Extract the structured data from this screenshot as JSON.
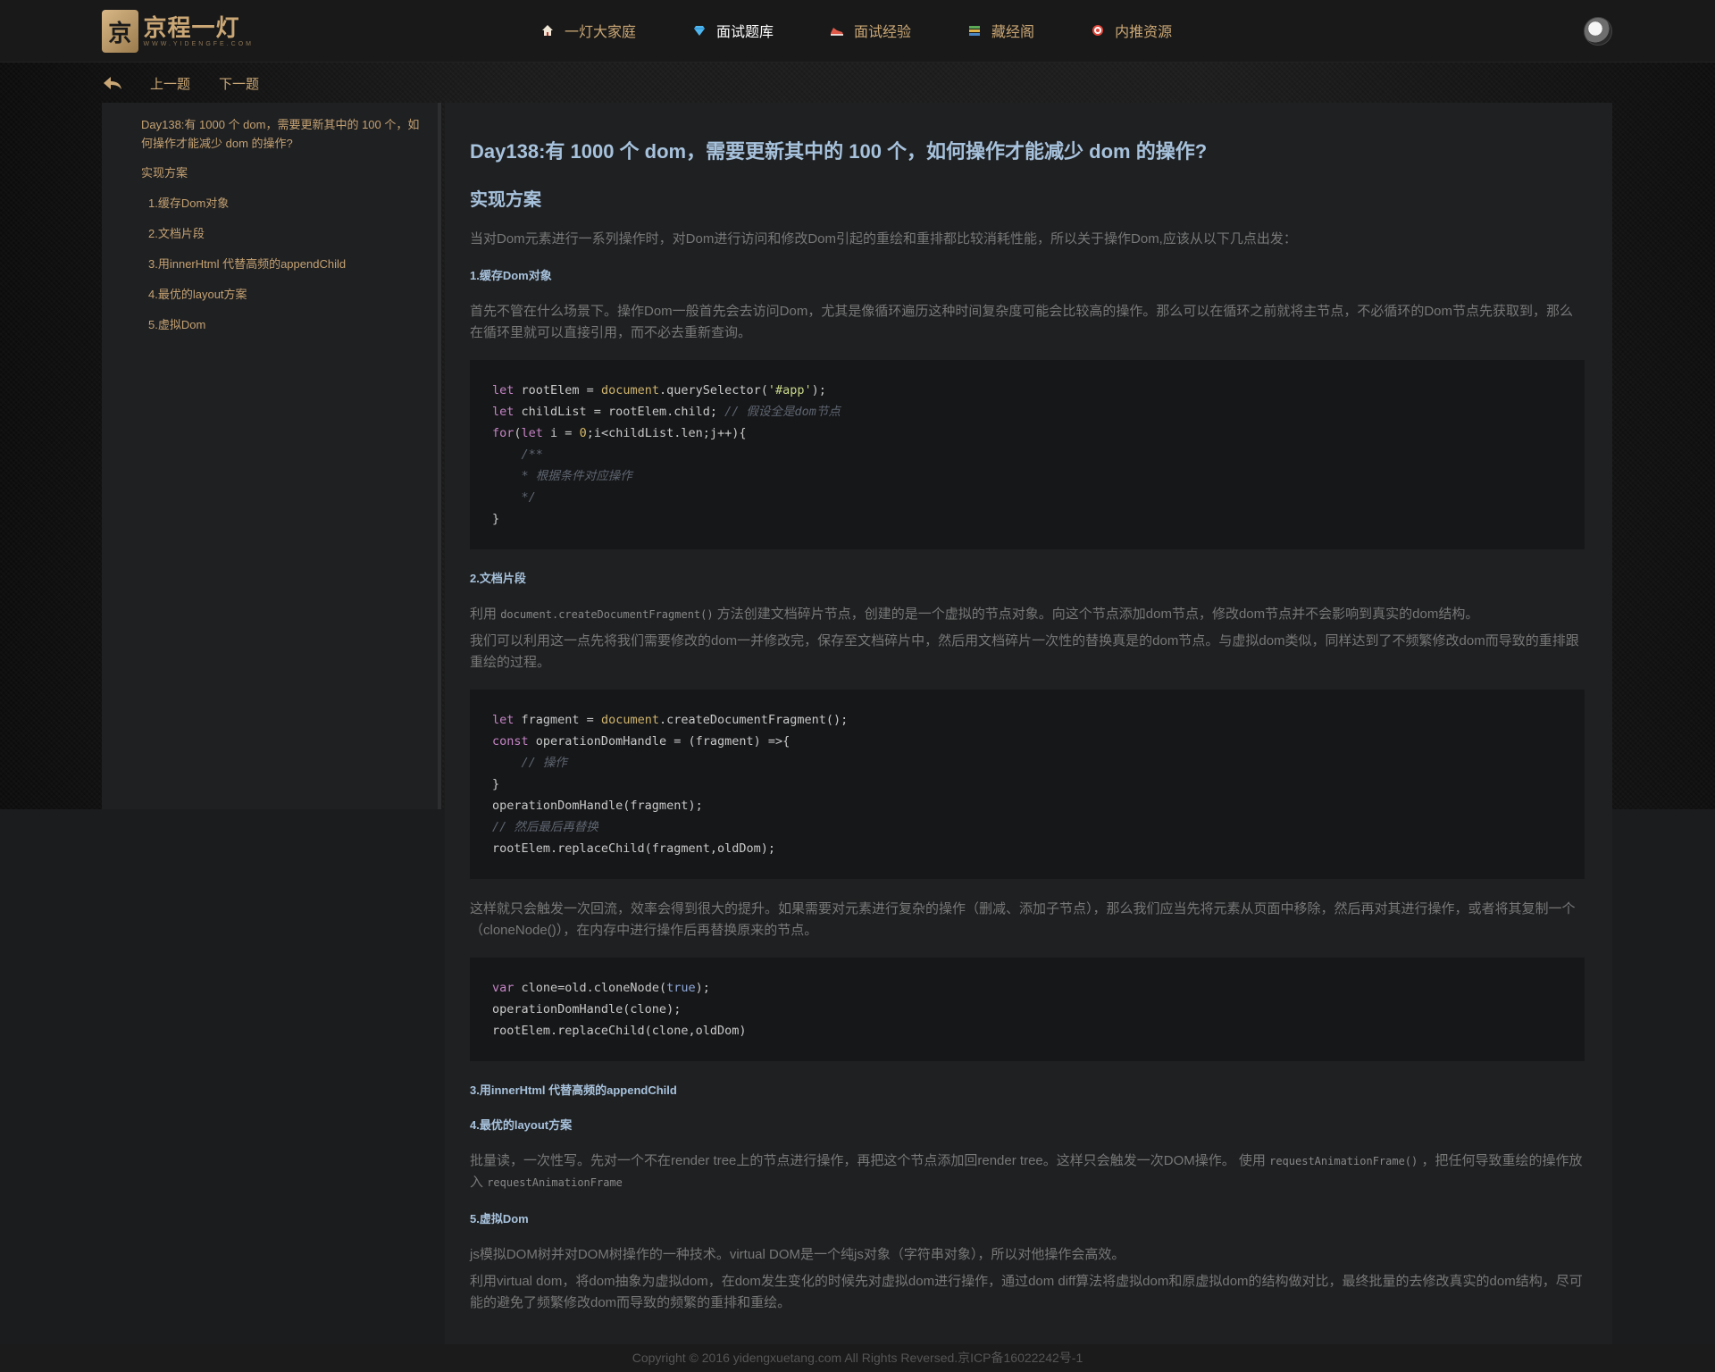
{
  "brand": {
    "logo_mark": "京",
    "name": "京程一灯",
    "subtitle": "WWW.YIDENGFE.COM"
  },
  "nav": {
    "items": [
      {
        "label": "一灯大家庭",
        "icon": "home-icon",
        "active": false
      },
      {
        "label": "面试题库",
        "icon": "diamond-icon",
        "active": true
      },
      {
        "label": "面试经验",
        "icon": "sneaker-icon",
        "active": false
      },
      {
        "label": "藏经阁",
        "icon": "books-icon",
        "active": false
      },
      {
        "label": "内推资源",
        "icon": "target-icon",
        "active": false
      }
    ]
  },
  "subnav": {
    "prev": "上一题",
    "next": "下一题"
  },
  "toc": {
    "title": "Day138:有 1000 个 dom，需要更新其中的 100 个，如何操作才能减少 dom 的操作?",
    "heading": "实现方案",
    "items": [
      "1.缓存Dom对象",
      "2.文档片段",
      "3.用innerHtml 代替高频的appendChild",
      "4.最优的layout方案",
      "5.虚拟Dom"
    ]
  },
  "article": {
    "title": "Day138:有 1000 个 dom，需要更新其中的 100 个，如何操作才能减少 dom 的操作?",
    "section": "实现方案",
    "intro": "当对Dom元素进行一系列操作时，对Dom进行访问和修改Dom引起的重绘和重排都比较消耗性能，所以关于操作Dom,应该从以下几点出发：",
    "s1_title": "1.缓存Dom对象",
    "s1_p": "首先不管在什么场景下。操作Dom一般首先会去访问Dom，尤其是像循环遍历这种时间复杂度可能会比较高的操作。那么可以在循环之前就将主节点，不必循环的Dom节点先获取到，那么在循环里就可以直接引用，而不必去重新查询。",
    "s2_title": "2.文档片段",
    "s2_p1_a": "利用",
    "s2_p1_code": "document.createDocumentFragment()",
    "s2_p1_b": "方法创建文档碎片节点，创建的是一个虚拟的节点对象。向这个节点添加dom节点，修改dom节点并不会影响到真实的dom结构。",
    "s2_p2": "我们可以利用这一点先将我们需要修改的dom一并修改完，保存至文档碎片中，然后用文档碎片一次性的替换真是的dom节点。与虚拟dom类似，同样达到了不频繁修改dom而导致的重排跟重绘的过程。",
    "s2_p3": "这样就只会触发一次回流，效率会得到很大的提升。如果需要对元素进行复杂的操作（删减、添加子节点），那么我们应当先将元素从页面中移除，然后再对其进行操作，或者将其复制一个（cloneNode()），在内存中进行操作后再替换原来的节点。",
    "s3_title": "3.用innerHtml 代替高频的appendChild",
    "s4_title": "4.最优的layout方案",
    "s4_p_a": "批量读，一次性写。先对一个不在render tree上的节点进行操作，再把这个节点添加回render tree。这样只会触发一次DOM操作。 使用",
    "s4_p_code1": "requestAnimationFrame()",
    "s4_p_b": "，把任何导致重绘的操作放入",
    "s4_p_code2": "requestAnimationFrame",
    "s5_title": "5.虚拟Dom",
    "s5_p1": "js模拟DOM树并对DOM树操作的一种技术。virtual DOM是一个纯js对象（字符串对象），所以对他操作会高效。",
    "s5_p2": "利用virtual dom，将dom抽象为虚拟dom，在dom发生变化的时候先对虚拟dom进行操作，通过dom diff算法将虚拟dom和原虚拟dom的结构做对比，最终批量的去修改真实的dom结构，尽可能的避免了频繁修改dom而导致的频繁的重排和重绘。"
  },
  "code": {
    "block1": [
      "let rootElem = document.querySelector('#app');",
      "let childList = rootElem.child; // 假设全是dom节点",
      "for(let i = 0;i<childList.len;j++){",
      "    /**",
      "    * 根据条件对应操作",
      "    */",
      "}"
    ],
    "block2": [
      "let fragment = document.createDocumentFragment();",
      "const operationDomHandle = (fragment) =>{",
      "    // 操作",
      "}",
      "operationDomHandle(fragment);",
      "// 然后最后再替换",
      "rootElem.replaceChild(fragment,oldDom);"
    ],
    "block3": [
      "var clone=old.cloneNode(true);",
      "operationDomHandle(clone);",
      "rootElem.replaceChild(clone,oldDom)"
    ]
  },
  "footer": {
    "copyright": "Copyright © 2016 yidengxuetang.com All Rights Reversed.京ICP备16022242号-1"
  },
  "colors": {
    "accent": "#caa775",
    "heading": "#a7c2dc",
    "background": "#1f2022"
  }
}
